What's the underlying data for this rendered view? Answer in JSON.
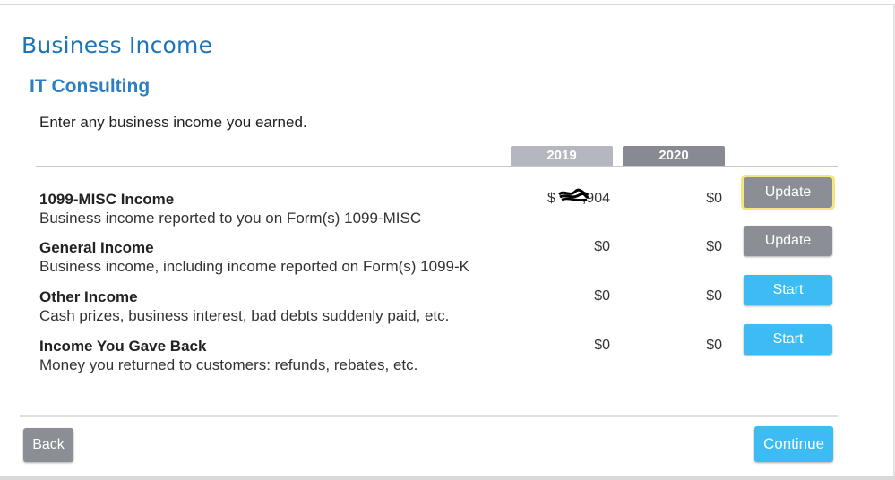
{
  "page": {
    "title": "Business Income",
    "subtitle": "IT Consulting",
    "instruction": "Enter any business income you earned."
  },
  "columns": {
    "year_prev": "2019",
    "year_curr": "2020"
  },
  "rows": [
    {
      "title": "1099-MISC Income",
      "description": "Business income reported to you on Form(s) 1099-MISC",
      "value_2019_prefix": "$",
      "value_2019_suffix": ",904",
      "value_2020": "$0",
      "action": "Update"
    },
    {
      "title": "General Income",
      "description": "Business income, including income reported on Form(s) 1099-K",
      "value_2019": "$0",
      "value_2020": "$0",
      "action": "Update"
    },
    {
      "title": "Other Income",
      "description": "Cash prizes, business interest, bad debts suddenly paid, etc.",
      "value_2019": "$0",
      "value_2020": "$0",
      "action": "Start"
    },
    {
      "title": "Income You Gave Back",
      "description": "Money you returned to customers: refunds, rebates, etc.",
      "value_2019": "$0",
      "value_2020": "$0",
      "action": "Start"
    }
  ],
  "footer": {
    "back_label": "Back",
    "continue_label": "Continue"
  },
  "colors": {
    "title_blue": "#1f74b6",
    "subtitle_blue": "#2b7fc4",
    "update_gray": "#8b8e94",
    "start_blue": "#3cbcf3",
    "focus_yellow": "#f5e680"
  }
}
